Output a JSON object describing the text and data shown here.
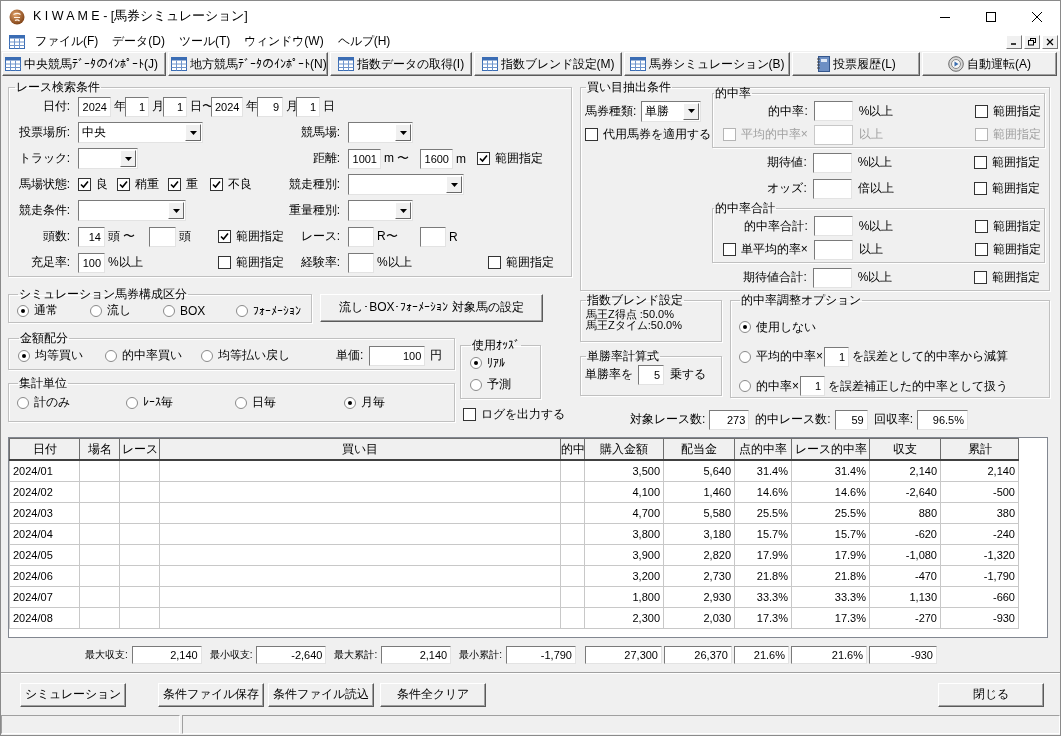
{
  "window": {
    "title": "K I W A M E - [馬券シミュレーション]"
  },
  "menu": [
    "ファイル(F)",
    "データ(D)",
    "ツール(T)",
    "ウィンドウ(W)",
    "ヘルプ(H)"
  ],
  "toolbar": [
    {
      "label": "中央競馬ﾃﾞｰﾀのｲﾝﾎﾟｰﾄ(J)",
      "kind": "table"
    },
    {
      "label": "地方競馬ﾃﾞｰﾀのｲﾝﾎﾟｰﾄ(N)",
      "kind": "table"
    },
    {
      "label": "指数データの取得(I)",
      "kind": "table"
    },
    {
      "label": "指数ブレンド設定(M)",
      "kind": "table"
    },
    {
      "label": "馬券シミュレーション(B)",
      "kind": "table"
    },
    {
      "label": "投票履歴(L)",
      "kind": "notebook"
    },
    {
      "label": "自動運転(A)",
      "kind": "disc"
    }
  ],
  "race_search": {
    "title": "レース検索条件",
    "rows": [
      {
        "label": "日付:",
        "left": [
          {
            "kind": "input",
            "value": "2024"
          },
          {
            "kind": "text",
            "text": "年"
          },
          {
            "kind": "input",
            "value": "1"
          },
          {
            "kind": "text",
            "text": "月"
          },
          {
            "kind": "input",
            "value": "1"
          },
          {
            "kind": "text",
            "text": "日〜"
          },
          {
            "kind": "input",
            "value": "2024"
          },
          {
            "kind": "text",
            "text": "年"
          },
          {
            "kind": "input",
            "value": "9"
          },
          {
            "kind": "text",
            "text": "月"
          },
          {
            "kind": "input",
            "value": "1"
          },
          {
            "kind": "text",
            "text": "日"
          }
        ]
      },
      {
        "label": "投票場所:",
        "left": [
          {
            "kind": "select",
            "value": "中央"
          }
        ],
        "right_label": "競馬場:",
        "right": [
          {
            "kind": "select"
          }
        ]
      },
      {
        "label": "トラック:",
        "left": [
          {
            "kind": "select"
          }
        ],
        "right_label": "距離:",
        "right": [
          {
            "kind": "input",
            "value": "1001"
          },
          {
            "kind": "text",
            "text": "m 〜"
          },
          {
            "kind": "input",
            "value": "1600"
          },
          {
            "kind": "text",
            "text": "m"
          },
          {
            "kind": "checkbox",
            "label": "範囲指定",
            "checked": true
          }
        ]
      },
      {
        "label": "馬場状態:",
        "left": [
          {
            "kind": "checkbox",
            "label": "良",
            "checked": true
          },
          {
            "kind": "checkbox",
            "label": "稍重",
            "checked": true
          },
          {
            "kind": "checkbox",
            "label": "重",
            "checked": true
          },
          {
            "kind": "checkbox",
            "label": "不良",
            "checked": true
          }
        ],
        "right_label": "競走種別:",
        "right": [
          {
            "kind": "select"
          }
        ]
      },
      {
        "label": "競走条件:",
        "left": [
          {
            "kind": "select"
          }
        ],
        "right_label": "重量種別:",
        "right": [
          {
            "kind": "select"
          }
        ]
      },
      {
        "label": "頭数:",
        "left": [
          {
            "kind": "input",
            "value": "14"
          },
          {
            "kind": "text",
            "text": "頭 〜"
          },
          {
            "kind": "input"
          },
          {
            "kind": "text",
            "text": "頭"
          },
          {
            "kind": "checkbox",
            "label": "範囲指定",
            "checked": true
          }
        ],
        "right_label": "レース:",
        "right": [
          {
            "kind": "input"
          },
          {
            "kind": "text",
            "text": "R〜"
          },
          {
            "kind": "input"
          },
          {
            "kind": "text",
            "text": "R"
          }
        ]
      },
      {
        "label": "充足率:",
        "left": [
          {
            "kind": "input",
            "value": "100"
          },
          {
            "kind": "text",
            "text": "%以上"
          },
          {
            "kind": "checkbox",
            "label": "範囲指定",
            "checked": false
          }
        ],
        "right_label": "経験率:",
        "right": [
          {
            "kind": "input"
          },
          {
            "kind": "text",
            "text": "%以上"
          },
          {
            "kind": "checkbox",
            "label": "範囲指定",
            "checked": false
          }
        ]
      }
    ]
  },
  "bet_conditions": {
    "title": "買い目抽出条件",
    "ticket_type": {
      "label": "馬券種類:",
      "value": "単勝"
    },
    "substitute": {
      "label": "代用馬券を適用する",
      "checked": false
    },
    "sections": [
      {
        "kind": "group",
        "title": "的中率",
        "rows": [
          {
            "kind": "field",
            "label": "的中率:",
            "unit": "%以上",
            "range": {
              "label": "範囲指定",
              "checked": false
            },
            "disabled": false
          },
          {
            "kind": "checkfield",
            "label": "平均的中率×",
            "checked": false,
            "unit": "以上",
            "range": {
              "label": "範囲指定",
              "checked": false
            },
            "disabled": true
          }
        ]
      },
      {
        "kind": "field",
        "label": "期待値:",
        "unit": "%以上",
        "range": {
          "label": "範囲指定",
          "checked": false
        },
        "disabled": false
      },
      {
        "kind": "field",
        "label": "オッズ:",
        "unit": "倍以上",
        "range": {
          "label": "範囲指定",
          "checked": false
        },
        "disabled": false
      },
      {
        "kind": "group",
        "title": "的中率合計",
        "rows": [
          {
            "kind": "field",
            "label": "的中率合計:",
            "unit": "%以上",
            "range": {
              "label": "範囲指定",
              "checked": false
            },
            "disabled": false
          },
          {
            "kind": "checkfield",
            "label": "単平均的率×",
            "checked": false,
            "unit": "以上",
            "range": {
              "label": "範囲指定",
              "checked": false
            },
            "disabled": false
          }
        ]
      },
      {
        "kind": "field",
        "label": "期待値合計:",
        "unit": "%以上",
        "range": {
          "label": "範囲指定",
          "checked": false
        },
        "disabled": false
      }
    ]
  },
  "composition": {
    "title": "シミュレーション馬券構成区分",
    "options": [
      {
        "label": "通常",
        "selected": true
      },
      {
        "label": "流し",
        "selected": false
      },
      {
        "label": "BOX",
        "selected": false
      },
      {
        "label": "ﾌｫｰﾒｰｼｮﾝ",
        "selected": false
      }
    ]
  },
  "setup_button": "流し･BOX･ﾌｫｰﾒｰｼｮﾝ  対象馬の設定",
  "allocation": {
    "title": "金額配分",
    "options": [
      {
        "label": "均等買い",
        "selected": true
      },
      {
        "label": "的中率買い",
        "selected": false
      },
      {
        "label": "均等払い戻し",
        "selected": false
      }
    ],
    "unit_price": {
      "label": "単価:",
      "value": "100",
      "unit": "円"
    }
  },
  "odds": {
    "title": "使用ｵｯｽﾞ",
    "options": [
      {
        "label": "ﾘｱﾙ",
        "selected": true
      },
      {
        "label": "予測",
        "selected": false
      }
    ]
  },
  "aggregation": {
    "title": "集計単位",
    "options": [
      {
        "label": "計のみ",
        "selected": false
      },
      {
        "label": "ﾚｰｽ毎",
        "selected": false
      },
      {
        "label": "日毎",
        "selected": false
      },
      {
        "label": "月毎",
        "selected": true
      }
    ]
  },
  "log_output": {
    "label": "ログを出力する",
    "checked": false
  },
  "index_blend": {
    "title": "指数ブレンド設定",
    "lines": [
      "馬王Z得点 :50.0%",
      "馬王Zタイム:50.0%"
    ]
  },
  "win_rate_formula": {
    "title": "単勝率計算式",
    "prefix": "単勝率を",
    "value": "5",
    "suffix": "乗する"
  },
  "adjustment": {
    "title": "的中率調整オプション",
    "options": [
      {
        "kind": "plain",
        "label": "使用しない",
        "selected": true
      },
      {
        "kind": "factor",
        "prefix": "平均的中率×",
        "value": "1",
        "suffix": "を誤差として的中率から減算",
        "selected": false
      },
      {
        "kind": "factor",
        "prefix": "的中率×",
        "value": "1",
        "suffix": "を誤差補正した的中率として扱う",
        "selected": false
      }
    ]
  },
  "stats": [
    {
      "label": "対象レース数:",
      "value": "273"
    },
    {
      "label": "的中レース数:",
      "value": "59"
    },
    {
      "label": "回収率:",
      "value": "96.5%"
    }
  ],
  "table": {
    "columns": [
      "日付",
      "場名",
      "レース",
      "買い目",
      "的中",
      "購入金額",
      "配当金",
      "点的中率",
      "レース的中率",
      "収支",
      "累計"
    ],
    "rows": [
      {
        "date": "2024/01",
        "purchase": "3,500",
        "payout": "5,640",
        "point_hit_rate": "31.4%",
        "race_hit_rate": "31.4%",
        "balance": "2,140",
        "cumulative": "2,140"
      },
      {
        "date": "2024/02",
        "purchase": "4,100",
        "payout": "1,460",
        "point_hit_rate": "14.6%",
        "race_hit_rate": "14.6%",
        "balance": "-2,640",
        "cumulative": "-500"
      },
      {
        "date": "2024/03",
        "purchase": "4,700",
        "payout": "5,580",
        "point_hit_rate": "25.5%",
        "race_hit_rate": "25.5%",
        "balance": "880",
        "cumulative": "380"
      },
      {
        "date": "2024/04",
        "purchase": "3,800",
        "payout": "3,180",
        "point_hit_rate": "15.7%",
        "race_hit_rate": "15.7%",
        "balance": "-620",
        "cumulative": "-240"
      },
      {
        "date": "2024/05",
        "purchase": "3,900",
        "payout": "2,820",
        "point_hit_rate": "17.9%",
        "race_hit_rate": "17.9%",
        "balance": "-1,080",
        "cumulative": "-1,320"
      },
      {
        "date": "2024/06",
        "purchase": "3,200",
        "payout": "2,730",
        "point_hit_rate": "21.8%",
        "race_hit_rate": "21.8%",
        "balance": "-470",
        "cumulative": "-1,790"
      },
      {
        "date": "2024/07",
        "purchase": "1,800",
        "payout": "2,930",
        "point_hit_rate": "33.3%",
        "race_hit_rate": "33.3%",
        "balance": "1,130",
        "cumulative": "-660"
      },
      {
        "date": "2024/08",
        "purchase": "2,300",
        "payout": "2,030",
        "point_hit_rate": "17.3%",
        "race_hit_rate": "17.3%",
        "balance": "-270",
        "cumulative": "-930"
      }
    ]
  },
  "summary": {
    "stats": [
      {
        "label": "最大収支:",
        "value": "2,140"
      },
      {
        "label": "最小収支:",
        "value": "-2,640"
      },
      {
        "label": "最大累計:",
        "value": "2,140"
      },
      {
        "label": "最小累計:",
        "value": "-1,790"
      }
    ],
    "totals": [
      "27,300",
      "26,370",
      "21.6%",
      "21.6%",
      "-930"
    ]
  },
  "buttons": [
    "シミュレーション",
    "条件ファイル保存",
    "条件ファイル読込",
    "条件全クリア"
  ],
  "close_button": "閉じる"
}
